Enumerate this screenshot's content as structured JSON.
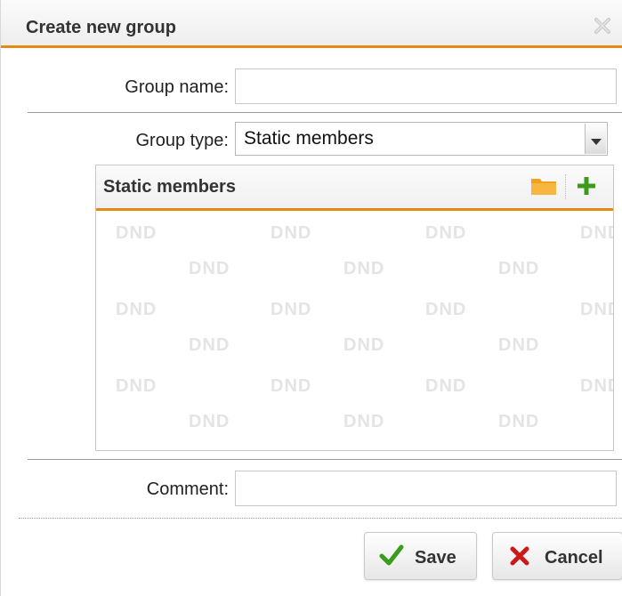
{
  "dialog": {
    "title": "Create new group",
    "close_icon": "close-icon"
  },
  "form": {
    "group_name_label": "Group name:",
    "group_name_value": "",
    "group_type_label": "Group type:",
    "group_type_value": "Static members",
    "comment_label": "Comment:",
    "comment_value": ""
  },
  "static_members": {
    "title": "Static members",
    "actions": [
      "folder-icon",
      "add-icon"
    ],
    "placeholder_text": "DND"
  },
  "buttons": {
    "save_label": "Save",
    "cancel_label": "Cancel"
  },
  "colors": {
    "accent": "#e58a12",
    "save_check": "#3b9b1c",
    "cancel_x": "#cc1a1a",
    "add_plus": "#3b9b1c",
    "folder": "#f0a21c"
  }
}
